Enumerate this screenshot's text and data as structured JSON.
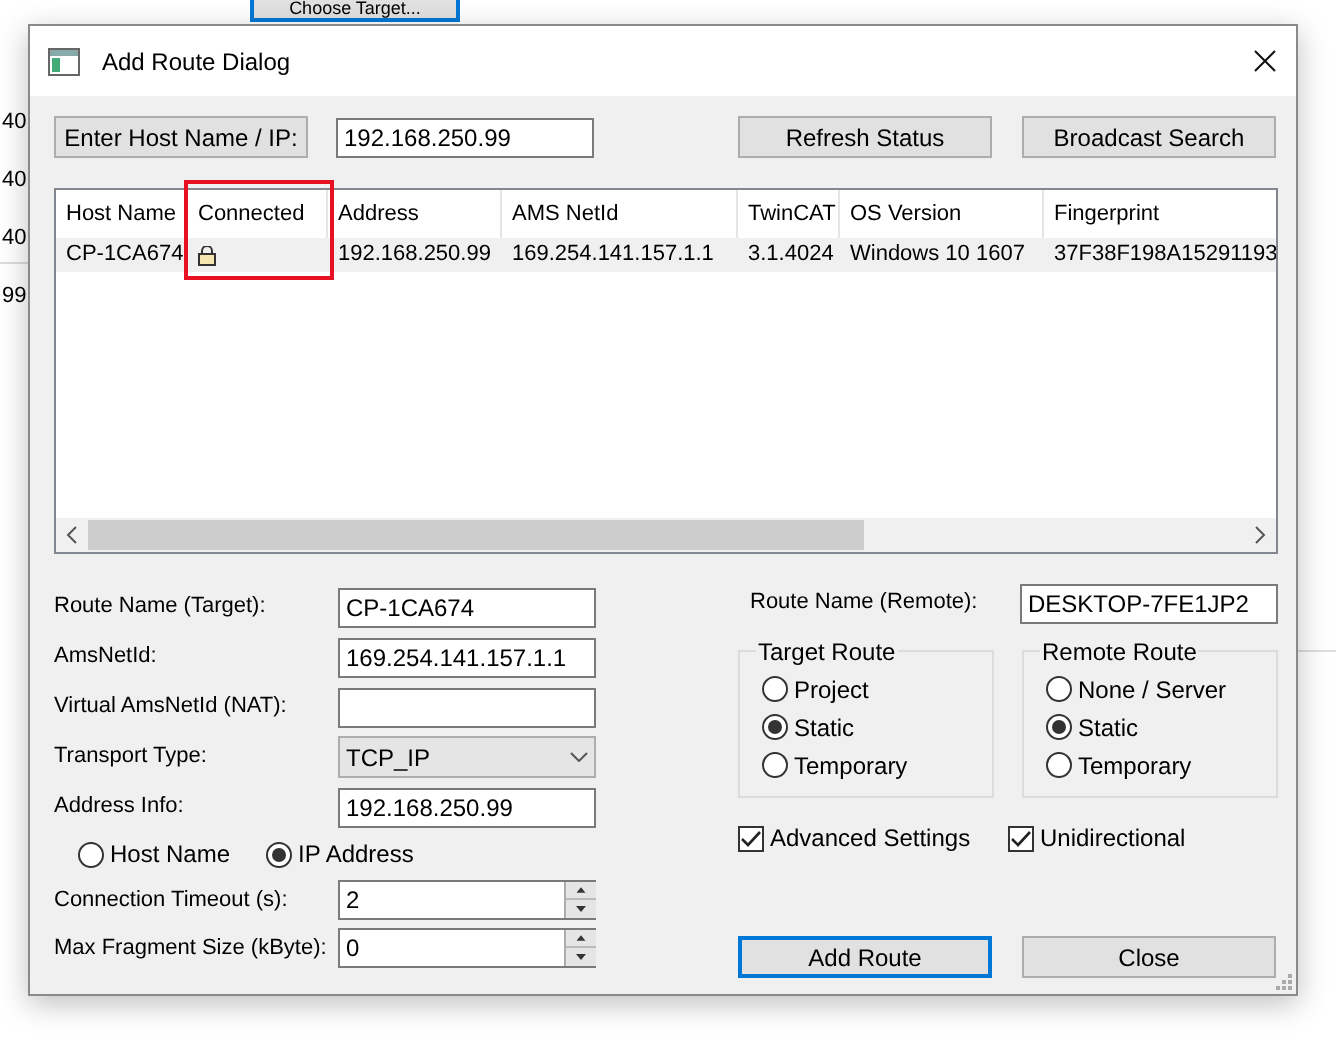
{
  "background": {
    "button": "Choose Target...",
    "fragments": [
      "40",
      "40",
      "40",
      "99"
    ]
  },
  "window": {
    "title": "Add Route Dialog"
  },
  "host_entry": {
    "button": "Enter Host Name / IP:",
    "value": "192.168.250.99"
  },
  "top_buttons": [
    "Refresh Status",
    "Broadcast Search"
  ],
  "table": {
    "columns": [
      {
        "label": "Host Name",
        "highlighted": false
      },
      {
        "label": "Connected",
        "highlighted": true
      },
      {
        "label": "Address",
        "highlighted": false
      },
      {
        "label": "AMS NetId",
        "highlighted": false
      },
      {
        "label": "TwinCAT",
        "highlighted": false
      },
      {
        "label": "OS Version",
        "highlighted": false
      },
      {
        "label": "Fingerprint",
        "highlighted": false
      }
    ],
    "rows": [
      {
        "selected": true,
        "connected": true,
        "cells": [
          "CP-1CA674",
          "",
          "192.168.250.99",
          "169.254.141.157.1.1",
          "3.1.4024",
          "Windows 10 1607",
          "37F38F198A15291193"
        ]
      }
    ]
  },
  "form": [
    {
      "kind": "text",
      "label": "Route Name (Target):",
      "value": "CP-1CA674"
    },
    {
      "kind": "text",
      "label": "AmsNetId:",
      "value": "169.254.141.157.1.1"
    },
    {
      "kind": "text",
      "label": "Virtual AmsNetId (NAT):"
    },
    {
      "kind": "combo",
      "label": "Transport Type:",
      "value": "TCP_IP"
    },
    {
      "kind": "text",
      "label": "Address Info:",
      "value": "192.168.250.99"
    },
    {
      "kind": "radios",
      "options": [
        {
          "label": "Host Name",
          "selected": false
        },
        {
          "label": "IP Address",
          "selected": true
        }
      ]
    },
    {
      "kind": "spin",
      "label": "Connection Timeout (s):",
      "value": "2"
    },
    {
      "kind": "spin",
      "label": "Max Fragment Size (kByte):",
      "value": "0"
    }
  ],
  "remote_route_name": {
    "label": "Route Name (Remote):",
    "value": "DESKTOP-7FE1JP2"
  },
  "groups": [
    {
      "title": "Target Route",
      "options": [
        {
          "label": "Project",
          "selected": false
        },
        {
          "label": "Static",
          "selected": true
        },
        {
          "label": "Temporary",
          "selected": false
        }
      ]
    },
    {
      "title": "Remote Route",
      "options": [
        {
          "label": "None / Server",
          "selected": false
        },
        {
          "label": "Static",
          "selected": true
        },
        {
          "label": "Temporary",
          "selected": false
        }
      ]
    }
  ],
  "checkboxes": [
    {
      "label": "Advanced Settings",
      "checked": true
    },
    {
      "label": "Unidirectional",
      "checked": true
    }
  ],
  "bottom_buttons": [
    {
      "label": "Add Route",
      "default": true
    },
    {
      "label": "Close",
      "default": false
    }
  ]
}
